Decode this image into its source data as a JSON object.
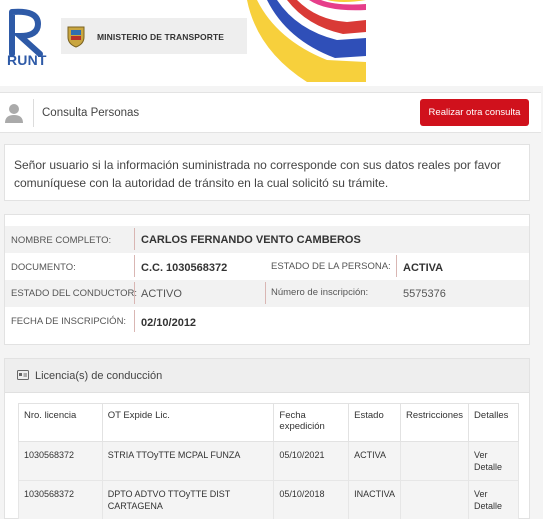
{
  "header": {
    "brand": "RUNT",
    "ministry": "MINISTERIO DE TRANSPORTE"
  },
  "title_bar": {
    "title": "Consulta Personas",
    "action_button": "Realizar otra consulta"
  },
  "notice": {
    "text": "Señor usuario si la información suministrada no corresponde con sus datos reales por favor comuníquese con la autoridad de tránsito en la cual solicitó su trámite."
  },
  "person": {
    "nombre_label": "NOMBRE COMPLETO:",
    "nombre_value": "CARLOS FERNANDO VENTO CAMBEROS",
    "documento_label": "DOCUMENTO:",
    "documento_value": "C.C. 1030568372",
    "estado_persona_label": "ESTADO DE LA PERSONA:",
    "estado_persona_value": "ACTIVA",
    "estado_conductor_label": "ESTADO DEL CONDUCTOR:",
    "estado_conductor_value": "ACTIVO",
    "numero_inscripcion_label": "Número de inscripción:",
    "numero_inscripcion_value": "5575376",
    "fecha_inscripcion_label": "FECHA DE INSCRIPCIÓN:",
    "fecha_inscripcion_value": "02/10/2012"
  },
  "licencias": {
    "title": "Licencia(s) de conducción",
    "columns": [
      "Nro. licencia",
      "OT Expide Lic.",
      "Fecha expedición",
      "Estado",
      "Restricciones",
      "Detalles"
    ],
    "rows": [
      {
        "nro": "1030568372",
        "ot": "STRIA TTOyTTE MCPAL FUNZA",
        "fecha": "05/10/2021",
        "estado": "ACTIVA",
        "restricciones": "",
        "detalles": "Ver Detalle"
      },
      {
        "nro": "1030568372",
        "ot": "DPTO ADTVO TTOyTTE DIST CARTAGENA",
        "fecha": "05/10/2018",
        "estado": "INACTIVA",
        "restricciones": "",
        "detalles": "Ver Detalle"
      }
    ]
  },
  "colors": {
    "brand_blue": "#2e5aa7",
    "action_red": "#d0111c",
    "panel_bg": "#f4f4f4"
  }
}
